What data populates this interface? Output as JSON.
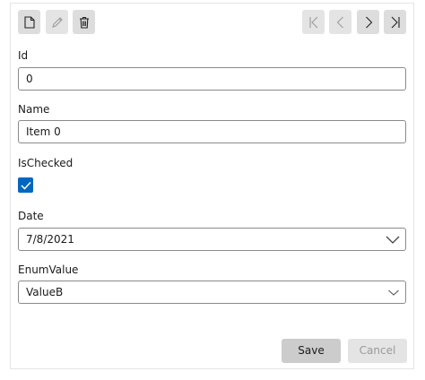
{
  "toolbar": {
    "new_icon": "new-document-icon",
    "edit_icon": "pencil-icon",
    "delete_icon": "trash-icon",
    "first_icon": "first-page-icon",
    "previous_icon": "chevron-left-icon",
    "next_icon": "chevron-right-icon",
    "last_icon": "last-page-icon"
  },
  "form": {
    "id": {
      "label": "Id",
      "value": "0"
    },
    "name": {
      "label": "Name",
      "value": "Item 0"
    },
    "ischecked": {
      "label": "IsChecked",
      "checked": true
    },
    "date": {
      "label": "Date",
      "value": "7/8/2021"
    },
    "enum": {
      "label": "EnumValue",
      "value": "ValueB"
    }
  },
  "buttons": {
    "save": "Save",
    "cancel": "Cancel"
  },
  "colors": {
    "accent": "#0067c0",
    "button_bg": "#cccccc",
    "disabled_bg": "#e4e4e4"
  }
}
